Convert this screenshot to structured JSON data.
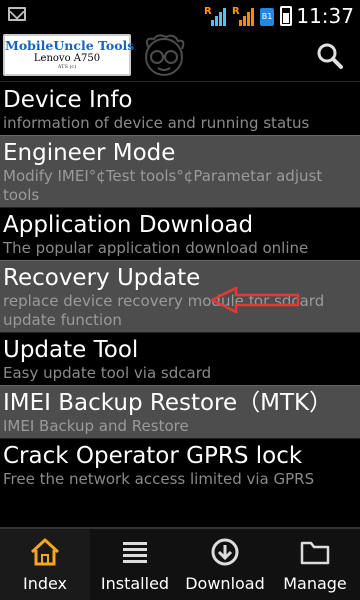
{
  "status_bar": {
    "time": "11:37",
    "sim_label": "B1",
    "roaming_label_1": "R",
    "roaming_label_2": "R"
  },
  "header": {
    "logo_title": "MobileUncle Tools",
    "logo_device": "Lenovo A750",
    "logo_subtitle": "ATS (c)"
  },
  "menu": {
    "items": [
      {
        "title": "Device Info",
        "subtitle": "information of device and running status"
      },
      {
        "title": "Engineer Mode",
        "subtitle": "Modify IMEI°¢Test tools°¢Parametar adjust tools"
      },
      {
        "title": "Application Download",
        "subtitle": "The popular application download online"
      },
      {
        "title": "Recovery Update",
        "subtitle": "replace device recovery module for sdcard update function"
      },
      {
        "title": "Update Tool",
        "subtitle": "Easy update tool via sdcard"
      },
      {
        "title": "IMEI Backup Restore（MTK）",
        "subtitle": "IMEI Backup and Restore"
      },
      {
        "title": "Crack Operator GPRS lock",
        "subtitle": "Free the network access limited via GPRS"
      }
    ]
  },
  "bottom_nav": {
    "items": [
      {
        "label": "Index",
        "icon": "home-icon"
      },
      {
        "label": "Installed",
        "icon": "list-icon"
      },
      {
        "label": "Download",
        "icon": "download-icon"
      },
      {
        "label": "Manage",
        "icon": "folder-icon"
      }
    ]
  },
  "colors": {
    "accent": "#f5a623",
    "alt_row": "#4d4d4d",
    "annotation_arrow": "#e53935"
  }
}
